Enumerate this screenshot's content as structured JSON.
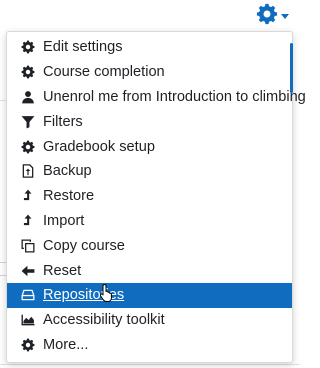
{
  "colors": {
    "accent": "#0f6cbf",
    "text": "#1d2125",
    "active_text": "#ffffff"
  },
  "trigger": {
    "icon": "gear-icon"
  },
  "menu": {
    "items": [
      {
        "label": "Edit settings",
        "icon": "gear-icon",
        "active": false
      },
      {
        "label": "Course completion",
        "icon": "gear-icon",
        "active": false
      },
      {
        "label": "Unenrol me from Introduction to climbing",
        "icon": "user-icon",
        "active": false
      },
      {
        "label": "Filters",
        "icon": "filter-icon",
        "active": false
      },
      {
        "label": "Gradebook setup",
        "icon": "gear-icon",
        "active": false
      },
      {
        "label": "Backup",
        "icon": "file-upload-icon",
        "active": false
      },
      {
        "label": "Restore",
        "icon": "level-up-icon",
        "active": false
      },
      {
        "label": "Import",
        "icon": "level-up-icon",
        "active": false
      },
      {
        "label": "Copy course",
        "icon": "copy-icon",
        "active": false
      },
      {
        "label": "Reset",
        "icon": "arrow-left-icon",
        "active": false
      },
      {
        "label": "Repositories",
        "icon": "hdd-icon",
        "active": true
      },
      {
        "label": "Accessibility toolkit",
        "icon": "area-chart-icon",
        "active": false
      },
      {
        "label": "More...",
        "icon": "gear-icon",
        "active": false
      }
    ]
  }
}
